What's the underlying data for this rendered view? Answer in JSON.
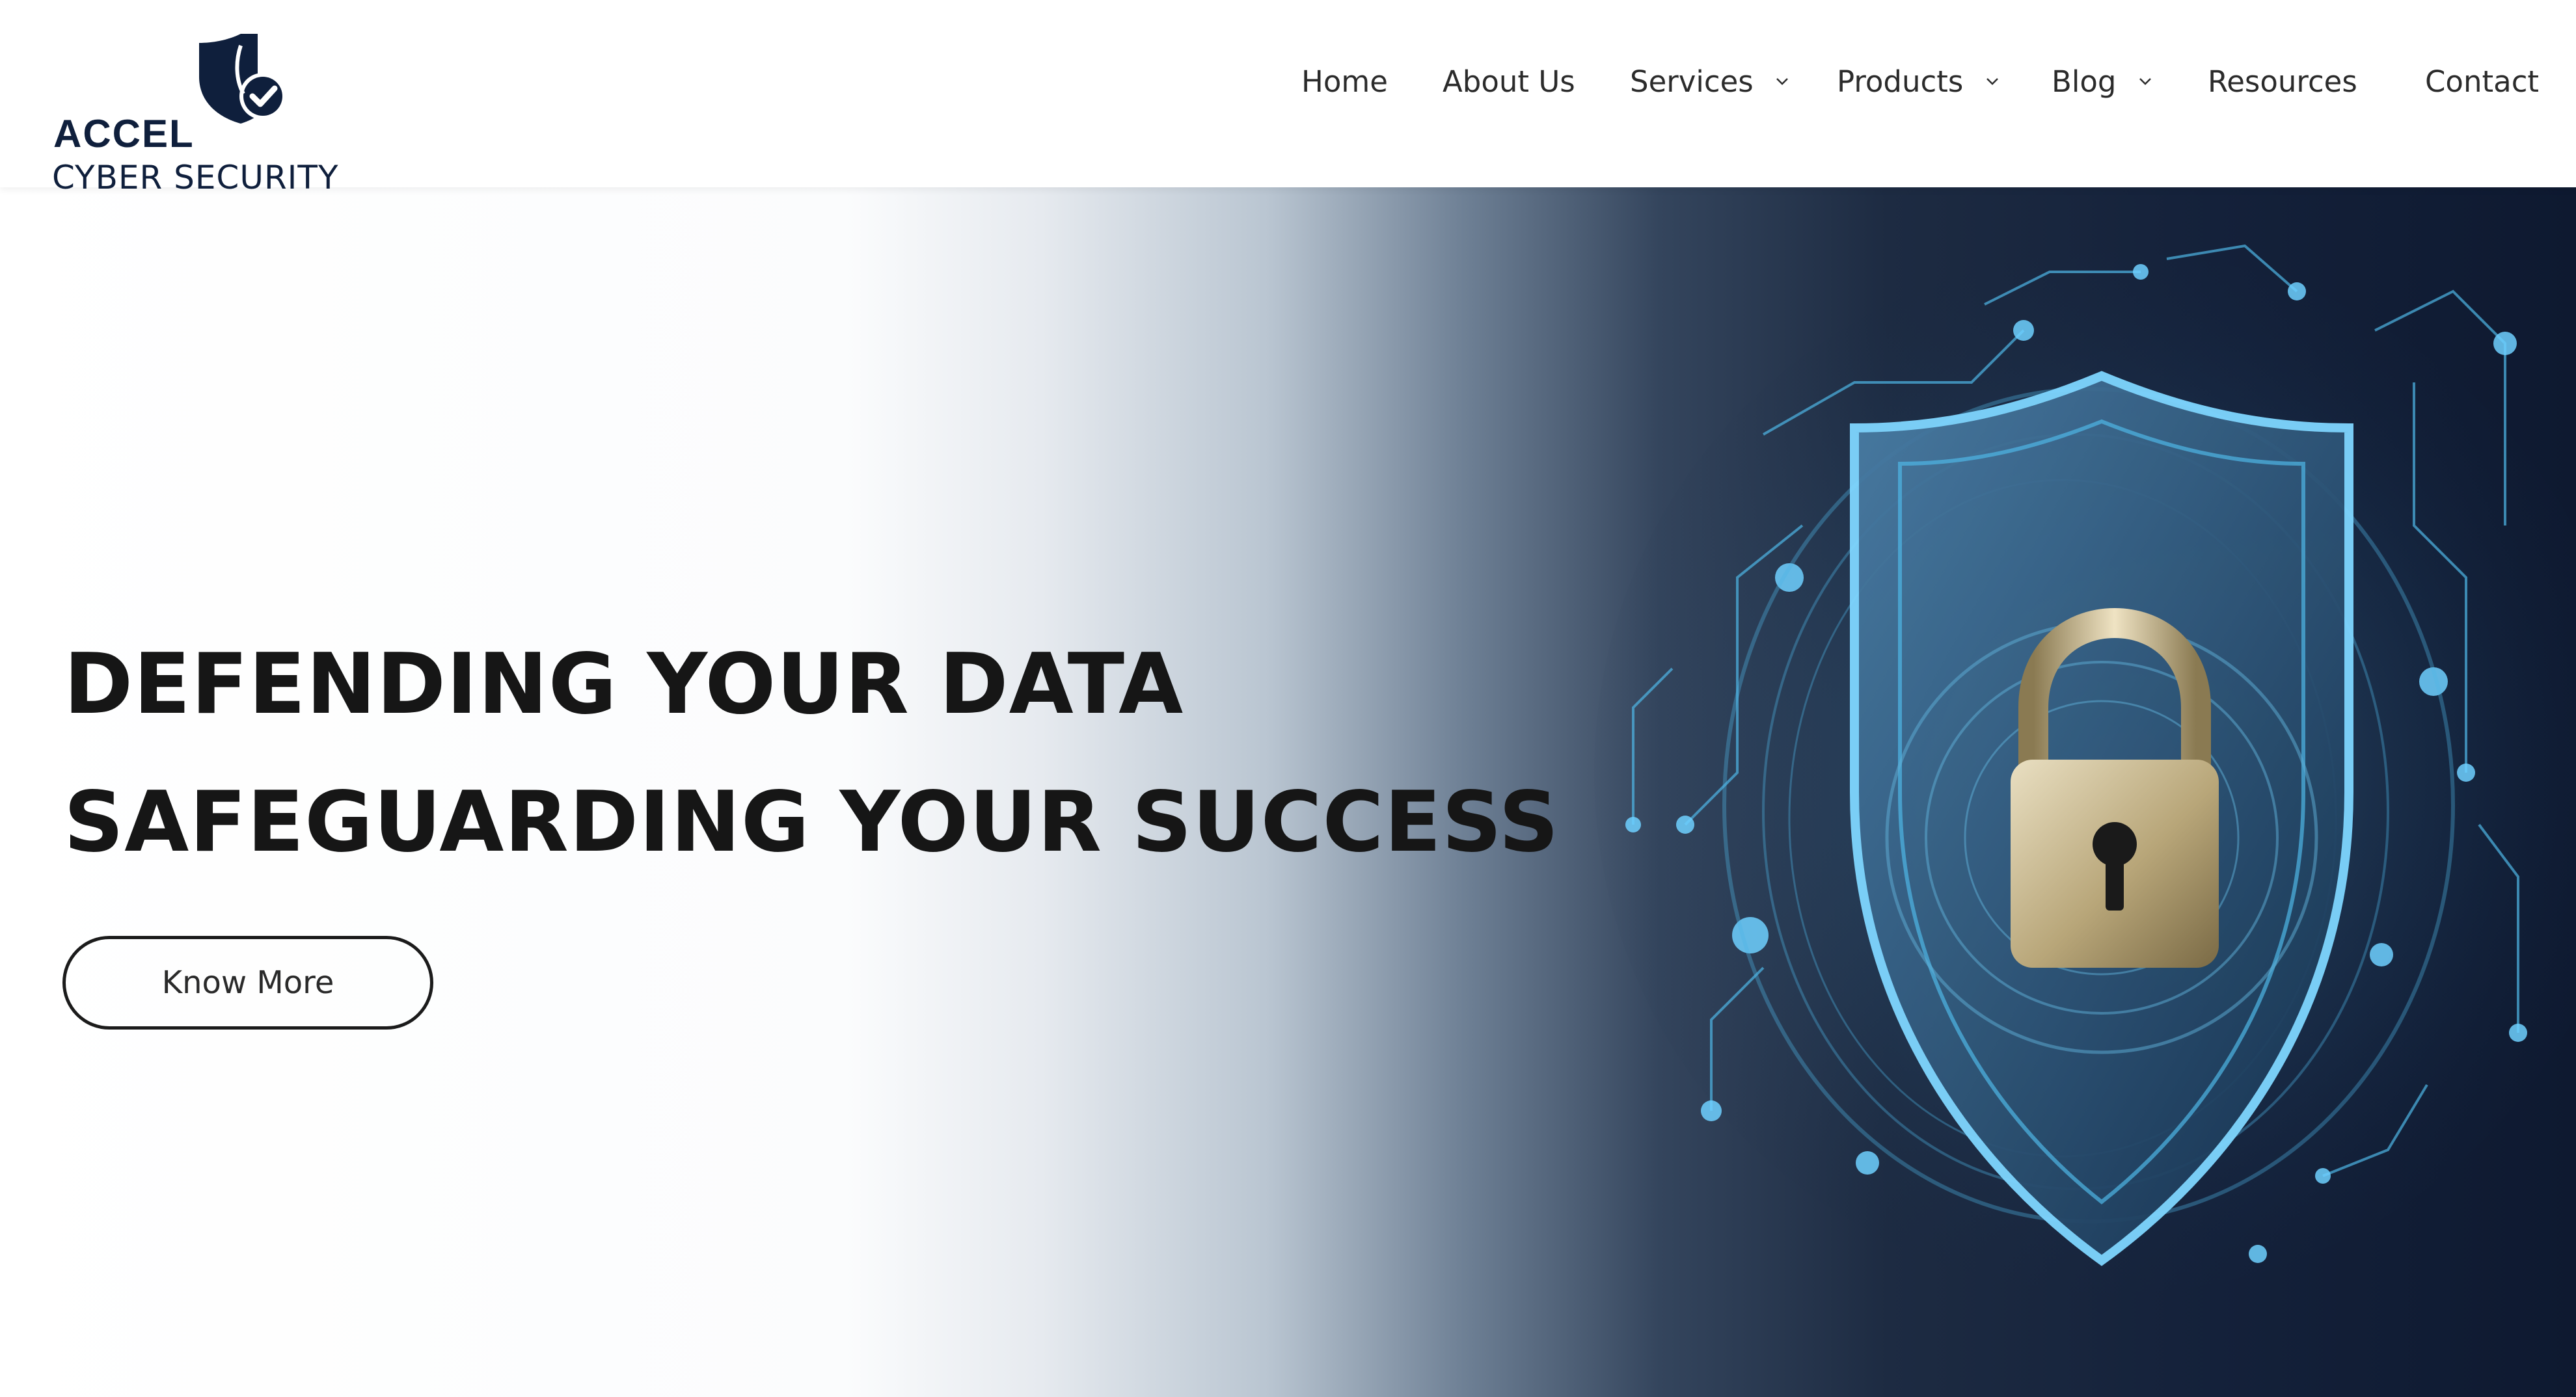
{
  "brand": {
    "name_primary": "ACCEL",
    "name_secondary": "CYBER SECURITY",
    "logo_color": "#0f1f3c"
  },
  "nav": {
    "items": [
      {
        "label": "Home",
        "has_dropdown": false
      },
      {
        "label": "About Us",
        "has_dropdown": false
      },
      {
        "label": "Services",
        "has_dropdown": true
      },
      {
        "label": "Products",
        "has_dropdown": true
      },
      {
        "label": "Blog",
        "has_dropdown": true
      },
      {
        "label": "Resources",
        "has_dropdown": false
      },
      {
        "label": "Contact",
        "has_dropdown": false
      }
    ]
  },
  "hero": {
    "headline_line_1": "DEFENDING YOUR DATA",
    "headline_line_2": "SAFEGUARDING YOUR SUCCESS",
    "cta_label": "Know More",
    "image_subject": "digital-shield-padlock-illustration",
    "accent_color": "#4fb6e6",
    "dark_color": "#0e1930"
  }
}
